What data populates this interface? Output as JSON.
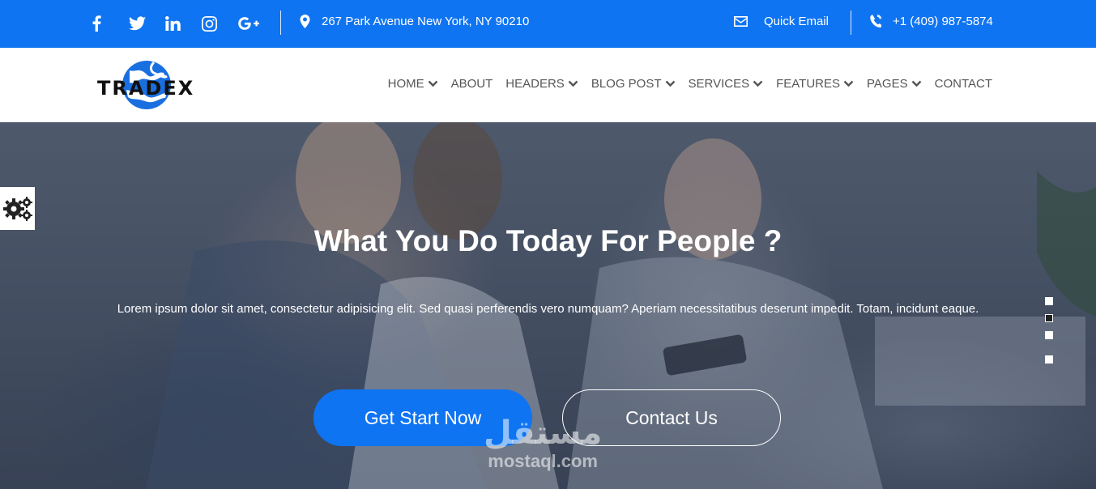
{
  "topbar": {
    "social": [
      {
        "icon": "facebook-icon"
      },
      {
        "icon": "twitter-icon"
      },
      {
        "icon": "linkedin-icon"
      },
      {
        "icon": "instagram-icon"
      },
      {
        "icon": "google-plus-icon"
      }
    ],
    "address": "267 Park Avenue New York, NY 90210",
    "email_label": "Quick Email",
    "phone": "+1 (409) 987-5874",
    "bg_color": "#0f74f2"
  },
  "header": {
    "logo_text": "TRADEX",
    "nav": [
      {
        "label": "HOME",
        "dropdown": true
      },
      {
        "label": "ABOUT",
        "dropdown": false
      },
      {
        "label": "HEADERS",
        "dropdown": true
      },
      {
        "label": "BLOG POST",
        "dropdown": true
      },
      {
        "label": "SERVICES",
        "dropdown": true
      },
      {
        "label": "FEATURES",
        "dropdown": true
      },
      {
        "label": "PAGES",
        "dropdown": true
      },
      {
        "label": "CONTACT",
        "dropdown": false
      }
    ]
  },
  "hero": {
    "title": "What You Do Today For People ?",
    "text": "Lorem ipsum dolor sit amet, consectetur adipisicing elit. Sed quasi perferendis vero numquam? Aperiam necessitatibus deserunt impedit. Totam, incidunt eaque.",
    "primary_button": "Get Start Now",
    "secondary_button": "Contact Us",
    "slides_total": 4,
    "active_slide": 2,
    "accent_color": "#0f74f2"
  },
  "watermark": {
    "arabic": "مستقل",
    "latin": "mostaql.com"
  }
}
